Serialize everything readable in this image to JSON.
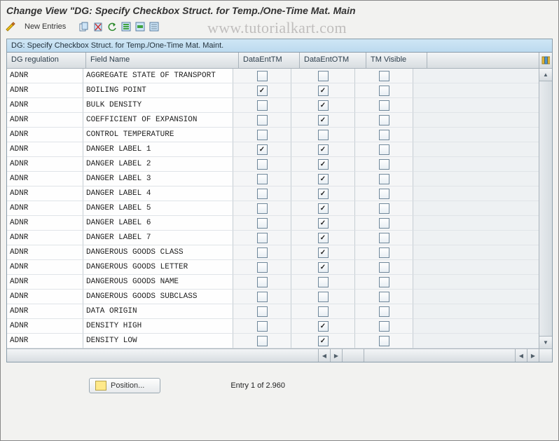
{
  "title": "Change View \"DG: Specify Checkbox Struct. for Temp./One-Time Mat. Main",
  "toolbar": {
    "new_entries": "New Entries"
  },
  "watermark": "www.tutorialkart.com",
  "panel_title": "DG: Specify Checkbox Struct. for Temp./One-Time Mat. Maint.",
  "columns": {
    "reg": "DG regulation",
    "field": "Field Name",
    "c1": "DataEntTM",
    "c2": "DataEntOTM",
    "c3": "TM Visible"
  },
  "rows": [
    {
      "reg": "ADNR",
      "field": "AGGREGATE STATE OF TRANSPORT",
      "c1": false,
      "c2": false,
      "c3": false
    },
    {
      "reg": "ADNR",
      "field": "BOILING POINT",
      "c1": true,
      "c2": true,
      "c3": false
    },
    {
      "reg": "ADNR",
      "field": "BULK DENSITY",
      "c1": false,
      "c2": true,
      "c3": false
    },
    {
      "reg": "ADNR",
      "field": "COEFFICIENT OF EXPANSION",
      "c1": false,
      "c2": true,
      "c3": false
    },
    {
      "reg": "ADNR",
      "field": "CONTROL TEMPERATURE",
      "c1": false,
      "c2": false,
      "c3": false
    },
    {
      "reg": "ADNR",
      "field": "DANGER LABEL 1",
      "c1": true,
      "c2": true,
      "c3": false
    },
    {
      "reg": "ADNR",
      "field": "DANGER LABEL 2",
      "c1": false,
      "c2": true,
      "c3": false
    },
    {
      "reg": "ADNR",
      "field": "DANGER LABEL 3",
      "c1": false,
      "c2": true,
      "c3": false
    },
    {
      "reg": "ADNR",
      "field": "DANGER LABEL 4",
      "c1": false,
      "c2": true,
      "c3": false
    },
    {
      "reg": "ADNR",
      "field": "DANGER LABEL 5",
      "c1": false,
      "c2": true,
      "c3": false
    },
    {
      "reg": "ADNR",
      "field": "DANGER LABEL 6",
      "c1": false,
      "c2": true,
      "c3": false
    },
    {
      "reg": "ADNR",
      "field": "DANGER LABEL 7",
      "c1": false,
      "c2": true,
      "c3": false
    },
    {
      "reg": "ADNR",
      "field": "DANGEROUS GOODS CLASS",
      "c1": false,
      "c2": true,
      "c3": false
    },
    {
      "reg": "ADNR",
      "field": "DANGEROUS GOODS LETTER",
      "c1": false,
      "c2": true,
      "c3": false
    },
    {
      "reg": "ADNR",
      "field": "DANGEROUS GOODS NAME",
      "c1": false,
      "c2": false,
      "c3": false
    },
    {
      "reg": "ADNR",
      "field": "DANGEROUS GOODS SUBCLASS",
      "c1": false,
      "c2": false,
      "c3": false
    },
    {
      "reg": "ADNR",
      "field": "DATA ORIGIN",
      "c1": false,
      "c2": false,
      "c3": false
    },
    {
      "reg": "ADNR",
      "field": "DENSITY HIGH",
      "c1": false,
      "c2": true,
      "c3": false
    },
    {
      "reg": "ADNR",
      "field": "DENSITY LOW",
      "c1": false,
      "c2": true,
      "c3": false
    }
  ],
  "position_button": "Position...",
  "entry_info": "Entry 1 of 2.960"
}
